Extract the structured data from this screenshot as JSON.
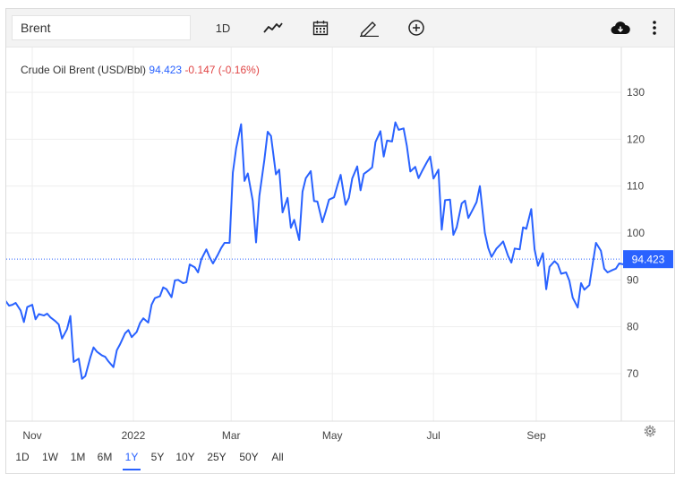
{
  "toolbar": {
    "symbol": "Brent",
    "interval": "1D",
    "icons": [
      "line-chart-icon",
      "calendar-icon",
      "pencil-icon",
      "plus-circle-icon",
      "cloud-download-icon",
      "more-vertical-icon"
    ]
  },
  "legend": {
    "name": "Crude Oil Brent (USD/Bbl)",
    "price": "94.423",
    "change": "-0.147 (-0.16%)"
  },
  "ranges": [
    "1D",
    "1W",
    "1M",
    "6M",
    "1Y",
    "5Y",
    "10Y",
    "25Y",
    "50Y",
    "All"
  ],
  "active_range": "1Y",
  "colors": {
    "line": "#2962ff",
    "change_negative": "#e04545",
    "last_price_label": "#2962ff"
  },
  "chart_data": {
    "type": "line",
    "title": "Crude Oil Brent (USD/Bbl)",
    "xlabel": "",
    "ylabel": "",
    "ylim": [
      60,
      138
    ],
    "yticks": [
      70,
      80,
      90,
      100,
      110,
      120,
      130
    ],
    "xtick_labels": [
      {
        "date": "2021-11-01",
        "label": "Nov"
      },
      {
        "date": "2022-01-01",
        "label": "2022"
      },
      {
        "date": "2022-03-01",
        "label": "Mar"
      },
      {
        "date": "2022-05-01",
        "label": "May"
      },
      {
        "date": "2022-07-01",
        "label": "Jul"
      },
      {
        "date": "2022-09-01",
        "label": "Sep"
      }
    ],
    "last_value": 94.423,
    "grid": true,
    "series": [
      {
        "values": [
          [
            "2021-10-05",
            84.8
          ],
          [
            "2021-10-07",
            84.2
          ],
          [
            "2021-10-09",
            85.8
          ],
          [
            "2021-10-11",
            85.0
          ],
          [
            "2021-10-13",
            85.6
          ],
          [
            "2021-10-15",
            86.0
          ],
          [
            "2021-10-18",
            84.5
          ],
          [
            "2021-10-20",
            84.7
          ],
          [
            "2021-10-22",
            85.1
          ],
          [
            "2021-10-25",
            83.5
          ],
          [
            "2021-10-27",
            81.0
          ],
          [
            "2021-10-29",
            84.2
          ],
          [
            "2021-11-01",
            84.7
          ],
          [
            "2021-11-03",
            81.6
          ],
          [
            "2021-11-05",
            82.7
          ],
          [
            "2021-11-08",
            82.4
          ],
          [
            "2021-11-10",
            82.8
          ],
          [
            "2021-11-12",
            82.0
          ],
          [
            "2021-11-15",
            81.2
          ],
          [
            "2021-11-17",
            80.5
          ],
          [
            "2021-11-19",
            77.5
          ],
          [
            "2021-11-22",
            79.5
          ],
          [
            "2021-11-24",
            82.3
          ],
          [
            "2021-11-26",
            72.5
          ],
          [
            "2021-11-29",
            73.2
          ],
          [
            "2021-12-01",
            68.9
          ],
          [
            "2021-12-03",
            69.5
          ],
          [
            "2021-12-06",
            73.4
          ],
          [
            "2021-12-08",
            75.6
          ],
          [
            "2021-12-10",
            74.7
          ],
          [
            "2021-12-13",
            73.9
          ],
          [
            "2021-12-15",
            73.6
          ],
          [
            "2021-12-17",
            72.6
          ],
          [
            "2021-12-20",
            71.4
          ],
          [
            "2021-12-22",
            75.0
          ],
          [
            "2021-12-24",
            76.3
          ],
          [
            "2021-12-27",
            78.6
          ],
          [
            "2021-12-29",
            79.3
          ],
          [
            "2021-12-31",
            77.8
          ],
          [
            "2022-01-03",
            78.9
          ],
          [
            "2022-01-05",
            80.8
          ],
          [
            "2022-01-07",
            81.8
          ],
          [
            "2022-01-10",
            80.9
          ],
          [
            "2022-01-12",
            84.7
          ],
          [
            "2022-01-14",
            86.1
          ],
          [
            "2022-01-17",
            86.5
          ],
          [
            "2022-01-19",
            88.4
          ],
          [
            "2022-01-21",
            88.0
          ],
          [
            "2022-01-24",
            86.3
          ],
          [
            "2022-01-26",
            89.9
          ],
          [
            "2022-01-28",
            90.0
          ],
          [
            "2022-01-31",
            89.3
          ],
          [
            "2022-02-02",
            89.5
          ],
          [
            "2022-02-04",
            93.3
          ],
          [
            "2022-02-07",
            92.7
          ],
          [
            "2022-02-09",
            91.6
          ],
          [
            "2022-02-11",
            94.4
          ],
          [
            "2022-02-14",
            96.5
          ],
          [
            "2022-02-16",
            94.8
          ],
          [
            "2022-02-18",
            93.5
          ],
          [
            "2022-02-21",
            95.4
          ],
          [
            "2022-02-23",
            96.8
          ],
          [
            "2022-02-25",
            97.9
          ],
          [
            "2022-02-28",
            97.9
          ],
          [
            "2022-03-02",
            112.9
          ],
          [
            "2022-03-04",
            118.1
          ],
          [
            "2022-03-07",
            123.2
          ],
          [
            "2022-03-09",
            111.1
          ],
          [
            "2022-03-11",
            112.7
          ],
          [
            "2022-03-14",
            106.9
          ],
          [
            "2022-03-16",
            98.0
          ],
          [
            "2022-03-18",
            107.9
          ],
          [
            "2022-03-21",
            115.6
          ],
          [
            "2022-03-23",
            121.6
          ],
          [
            "2022-03-25",
            120.7
          ],
          [
            "2022-03-28",
            112.5
          ],
          [
            "2022-03-30",
            113.5
          ],
          [
            "2022-04-01",
            104.4
          ],
          [
            "2022-04-04",
            107.5
          ],
          [
            "2022-04-06",
            101.1
          ],
          [
            "2022-04-08",
            102.8
          ],
          [
            "2022-04-11",
            98.5
          ],
          [
            "2022-04-13",
            108.8
          ],
          [
            "2022-04-15",
            111.7
          ],
          [
            "2022-04-18",
            113.2
          ],
          [
            "2022-04-20",
            106.8
          ],
          [
            "2022-04-22",
            106.7
          ],
          [
            "2022-04-25",
            102.3
          ],
          [
            "2022-04-27",
            104.6
          ],
          [
            "2022-04-29",
            107.1
          ],
          [
            "2022-05-02",
            107.6
          ],
          [
            "2022-05-04",
            110.1
          ],
          [
            "2022-05-06",
            112.4
          ],
          [
            "2022-05-09",
            106.0
          ],
          [
            "2022-05-11",
            107.5
          ],
          [
            "2022-05-13",
            111.6
          ],
          [
            "2022-05-16",
            114.2
          ],
          [
            "2022-05-18",
            109.1
          ],
          [
            "2022-05-20",
            112.6
          ],
          [
            "2022-05-23",
            113.4
          ],
          [
            "2022-05-25",
            114.0
          ],
          [
            "2022-05-27",
            119.4
          ],
          [
            "2022-05-30",
            121.7
          ],
          [
            "2022-06-01",
            116.3
          ],
          [
            "2022-06-03",
            119.7
          ],
          [
            "2022-06-06",
            119.5
          ],
          [
            "2022-06-08",
            123.6
          ],
          [
            "2022-06-10",
            122.0
          ],
          [
            "2022-06-13",
            122.3
          ],
          [
            "2022-06-15",
            118.5
          ],
          [
            "2022-06-17",
            113.1
          ],
          [
            "2022-06-20",
            114.1
          ],
          [
            "2022-06-22",
            111.7
          ],
          [
            "2022-06-24",
            113.1
          ],
          [
            "2022-06-27",
            115.1
          ],
          [
            "2022-06-29",
            116.3
          ],
          [
            "2022-07-01",
            111.6
          ],
          [
            "2022-07-04",
            113.5
          ],
          [
            "2022-07-06",
            100.7
          ],
          [
            "2022-07-08",
            107.0
          ],
          [
            "2022-07-11",
            107.1
          ],
          [
            "2022-07-13",
            99.6
          ],
          [
            "2022-07-15",
            101.2
          ],
          [
            "2022-07-18",
            106.3
          ],
          [
            "2022-07-20",
            106.9
          ],
          [
            "2022-07-22",
            103.2
          ],
          [
            "2022-07-25",
            105.2
          ],
          [
            "2022-07-27",
            106.6
          ],
          [
            "2022-07-29",
            110.0
          ],
          [
            "2022-08-01",
            100.0
          ],
          [
            "2022-08-03",
            96.8
          ],
          [
            "2022-08-05",
            94.9
          ],
          [
            "2022-08-08",
            96.7
          ],
          [
            "2022-08-10",
            97.4
          ],
          [
            "2022-08-12",
            98.2
          ],
          [
            "2022-08-15",
            95.1
          ],
          [
            "2022-08-17",
            93.7
          ],
          [
            "2022-08-19",
            96.7
          ],
          [
            "2022-08-22",
            96.5
          ],
          [
            "2022-08-24",
            101.2
          ],
          [
            "2022-08-26",
            100.9
          ],
          [
            "2022-08-29",
            105.1
          ],
          [
            "2022-08-31",
            96.5
          ],
          [
            "2022-09-02",
            93.0
          ],
          [
            "2022-09-05",
            95.7
          ],
          [
            "2022-09-07",
            88.0
          ],
          [
            "2022-09-09",
            92.8
          ],
          [
            "2022-09-12",
            94.0
          ],
          [
            "2022-09-14",
            93.3
          ],
          [
            "2022-09-16",
            91.3
          ],
          [
            "2022-09-19",
            91.6
          ],
          [
            "2022-09-21",
            89.8
          ],
          [
            "2022-09-23",
            86.2
          ],
          [
            "2022-09-26",
            84.1
          ],
          [
            "2022-09-28",
            89.3
          ],
          [
            "2022-09-30",
            87.9
          ],
          [
            "2022-10-03",
            88.9
          ],
          [
            "2022-10-05",
            93.4
          ],
          [
            "2022-10-07",
            97.9
          ],
          [
            "2022-10-10",
            96.2
          ],
          [
            "2022-10-12",
            92.4
          ],
          [
            "2022-10-14",
            91.6
          ],
          [
            "2022-10-17",
            92.1
          ],
          [
            "2022-10-19",
            92.4
          ],
          [
            "2022-10-21",
            93.5
          ],
          [
            "2022-10-24",
            93.3
          ],
          [
            "2022-10-26",
            95.7
          ],
          [
            "2022-10-28",
            95.8
          ],
          [
            "2022-10-31",
            94.4
          ]
        ]
      }
    ]
  }
}
